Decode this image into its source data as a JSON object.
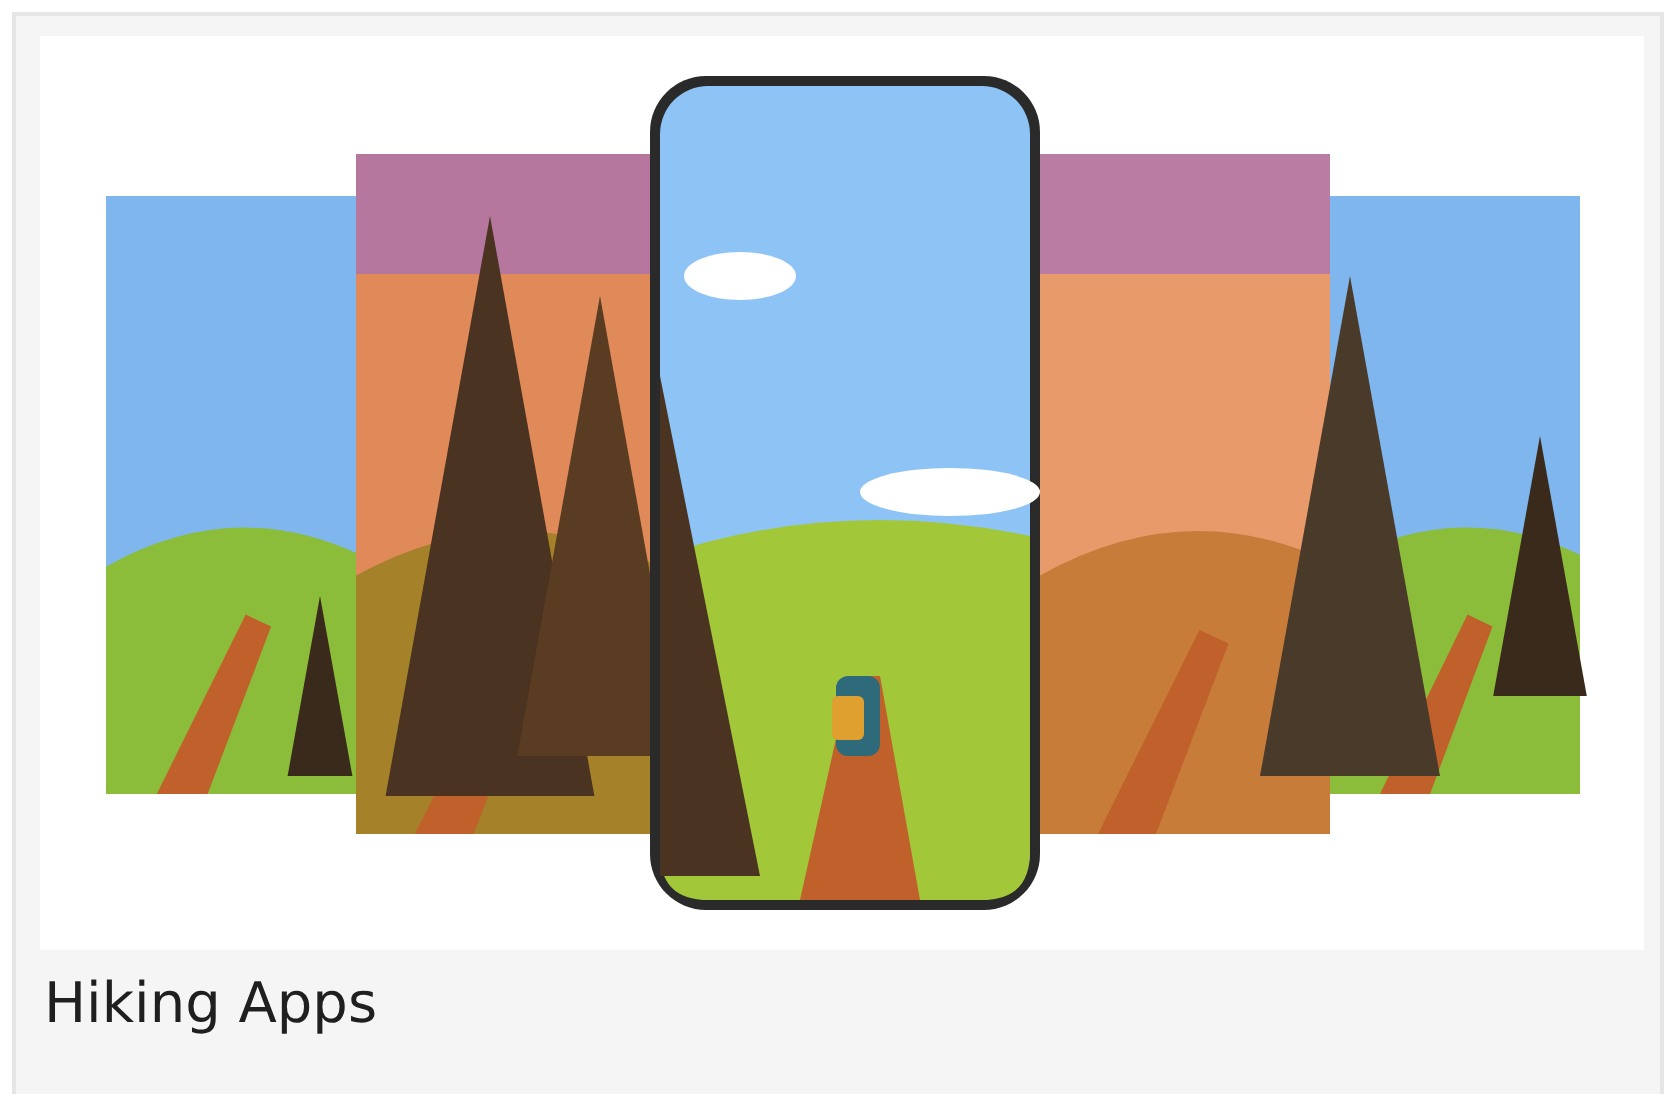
{
  "card": {
    "caption": "Hiking Apps"
  }
}
